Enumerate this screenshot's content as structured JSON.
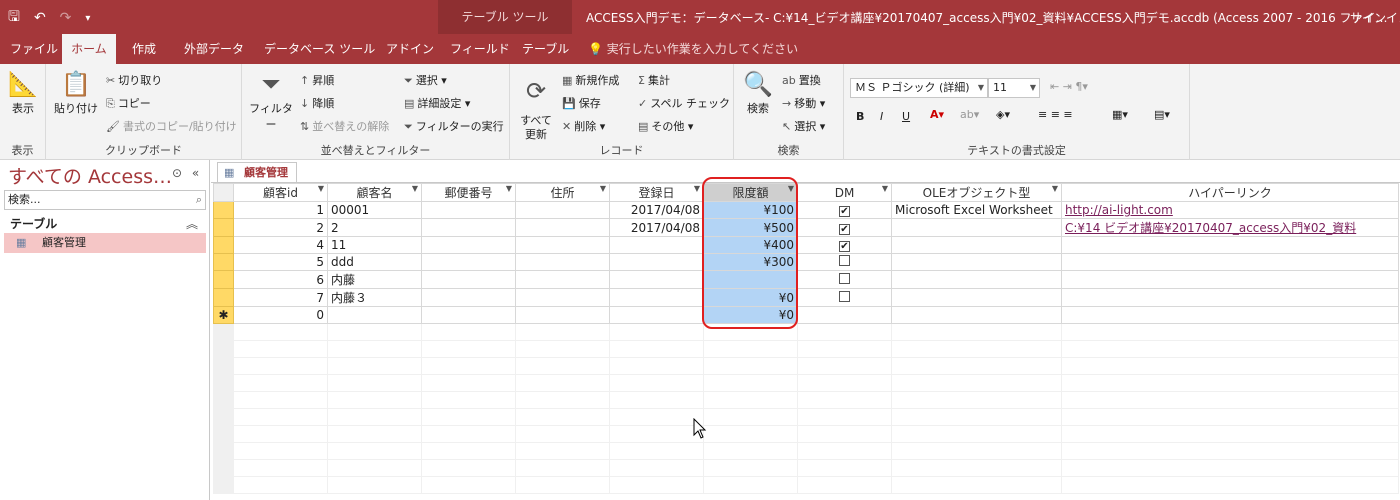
{
  "titlebar": {
    "context_tab": "テーブル ツール",
    "title": "ACCESS入門デモ：データベース- C:¥14_ビデオ講座¥20170407_access入門¥02_資料¥ACCESS入門デモ.accdb (Access 2007 - 2016 ファイ…",
    "signin": "サインイン"
  },
  "tabs": [
    "ファイル",
    "ホーム",
    "作成",
    "外部データ",
    "データベース ツール",
    "アドイン",
    "フィールド",
    "テーブル"
  ],
  "tell_me": "実行したい作業を入力してください",
  "ribbon": {
    "view": {
      "label": "表示",
      "group": "表示"
    },
    "clipboard": {
      "paste": "貼り付け",
      "cut": "切り取り",
      "copy": "コピー",
      "format_painter": "書式のコピー/貼り付け",
      "group": "クリップボード"
    },
    "sort_filter": {
      "filter": "フィルター",
      "asc": "昇順",
      "desc": "降順",
      "remove_sort": "並べ替えの解除",
      "selection": "選択",
      "advanced": "詳細設定",
      "toggle_filter": "フィルターの実行",
      "group": "並べ替えとフィルター"
    },
    "records": {
      "refresh": "すべて\n更新",
      "new": "新規作成",
      "save": "保存",
      "delete": "削除",
      "totals": "集計",
      "spelling": "スペル チェック",
      "more": "その他",
      "group": "レコード"
    },
    "find": {
      "find": "検索",
      "replace": "置換",
      "goto": "移動",
      "select": "選択",
      "group": "検索"
    },
    "text": {
      "font": "ＭＳ Ｐゴシック (詳細)",
      "size": "11",
      "group": "テキストの書式設定"
    }
  },
  "nav": {
    "title": "すべての Access…",
    "search_placeholder": "検索...",
    "category": "テーブル",
    "item": "顧客管理"
  },
  "document": {
    "tab": "顧客管理",
    "columns": [
      "顧客id",
      "顧客名",
      "郵便番号",
      "住所",
      "登録日",
      "限度額",
      "DM",
      "OLEオブジェクト型",
      "ハイパーリンク"
    ],
    "rows": [
      {
        "id": "1",
        "name": "00001",
        "zip": "",
        "addr": "",
        "date": "2017/04/08",
        "limit": "¥100",
        "dm": true,
        "ole": "Microsoft Excel Worksheet",
        "link": "http://ai-light.com"
      },
      {
        "id": "2",
        "name": "2",
        "zip": "",
        "addr": "",
        "date": "2017/04/08",
        "limit": "¥500",
        "dm": true,
        "ole": "",
        "link": "C:¥14 ビデオ講座¥20170407_access入門¥02_資料"
      },
      {
        "id": "4",
        "name": "11",
        "zip": "",
        "addr": "",
        "date": "",
        "limit": "¥400",
        "dm": true,
        "ole": "",
        "link": ""
      },
      {
        "id": "5",
        "name": "ddd",
        "zip": "",
        "addr": "",
        "date": "",
        "limit": "¥300",
        "dm": false,
        "ole": "",
        "link": ""
      },
      {
        "id": "6",
        "name": "内藤",
        "zip": "",
        "addr": "",
        "date": "",
        "limit": "",
        "dm": false,
        "ole": "",
        "link": ""
      },
      {
        "id": "7",
        "name": "内藤３",
        "zip": "",
        "addr": "",
        "date": "",
        "limit": "¥0",
        "dm": false,
        "ole": "",
        "link": ""
      }
    ],
    "new_row": {
      "marker": "✱",
      "id": "0",
      "limit": "¥0"
    }
  },
  "colors": {
    "accent": "#a4373a",
    "highlight": "#b3d4f5",
    "selector": "#ffd966",
    "annotation": "#e02020"
  }
}
